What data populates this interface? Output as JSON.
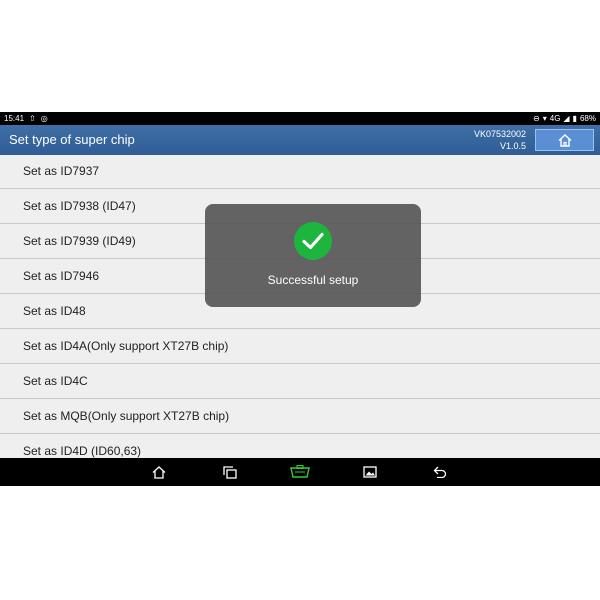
{
  "status": {
    "time": "15:41",
    "battery": "68%",
    "network": "4G",
    "left_icons": [
      "upload-icon",
      "notification-icon"
    ],
    "right_icons": [
      "do-not-disturb-icon",
      "wifi-icon",
      "signal-icon",
      "battery-icon"
    ]
  },
  "header": {
    "title": "Set type of super chip",
    "serial": "VK07532002",
    "version": "V1.0.5",
    "home_icon": "home-icon"
  },
  "list": {
    "items": [
      {
        "label": "Set as ID7937"
      },
      {
        "label": "Set as ID7938 (ID47)"
      },
      {
        "label": "Set as ID7939 (ID49)"
      },
      {
        "label": "Set as ID7946"
      },
      {
        "label": "Set as ID48"
      },
      {
        "label": "Set as ID4A(Only support XT27B chip)"
      },
      {
        "label": "Set as ID4C"
      },
      {
        "label": "Set as MQB(Only support XT27B chip)"
      },
      {
        "label": "Set as ID4D (ID60,63)"
      }
    ]
  },
  "toast": {
    "message": "Successful setup",
    "icon": "checkmark-icon",
    "color": "#1db53e"
  },
  "navbar": {
    "icons": [
      "home-icon",
      "recent-apps-icon",
      "vci-icon",
      "screenshot-icon",
      "back-icon"
    ]
  },
  "colors": {
    "header_bg": "#3a6aa3",
    "home_button_bg": "#5b8fd4",
    "list_bg": "#efefef"
  }
}
